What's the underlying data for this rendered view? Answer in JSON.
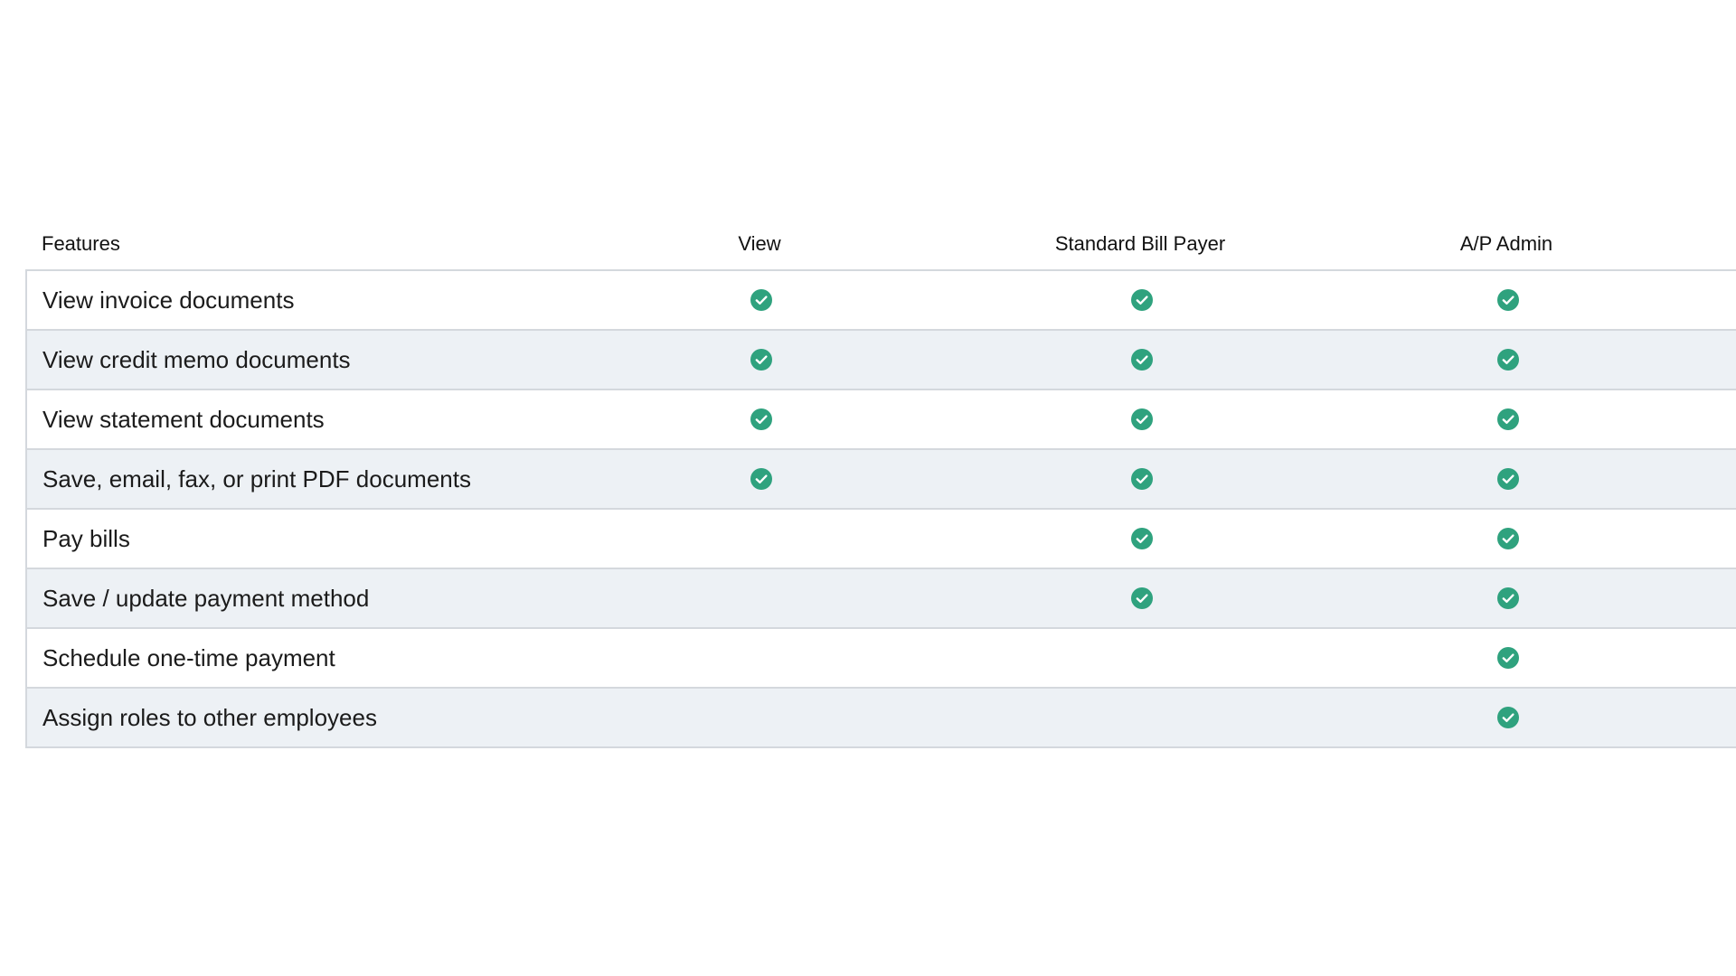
{
  "table": {
    "headers": {
      "feature": "Features",
      "view": "View",
      "standard_bill_payer": "Standard Bill Payer",
      "ap_admin": "A/P Admin"
    },
    "rows": [
      {
        "label": "View invoice documents",
        "view": true,
        "standard_bill_payer": true,
        "ap_admin": true
      },
      {
        "label": "View credit memo documents",
        "view": true,
        "standard_bill_payer": true,
        "ap_admin": true
      },
      {
        "label": "View statement documents",
        "view": true,
        "standard_bill_payer": true,
        "ap_admin": true
      },
      {
        "label": "Save, email, fax, or print PDF documents",
        "view": true,
        "standard_bill_payer": true,
        "ap_admin": true
      },
      {
        "label": "Pay bills",
        "view": false,
        "standard_bill_payer": true,
        "ap_admin": true
      },
      {
        "label": "Save / update payment method",
        "view": false,
        "standard_bill_payer": true,
        "ap_admin": true
      },
      {
        "label": "Schedule one-time payment",
        "view": false,
        "standard_bill_payer": false,
        "ap_admin": true
      },
      {
        "label": "Assign roles to other employees",
        "view": false,
        "standard_bill_payer": false,
        "ap_admin": true
      }
    ],
    "icon": "check-circle-icon",
    "colors": {
      "check": "#2fa27e",
      "alt_row": "#edf1f5",
      "border": "#d4d8dd"
    }
  }
}
